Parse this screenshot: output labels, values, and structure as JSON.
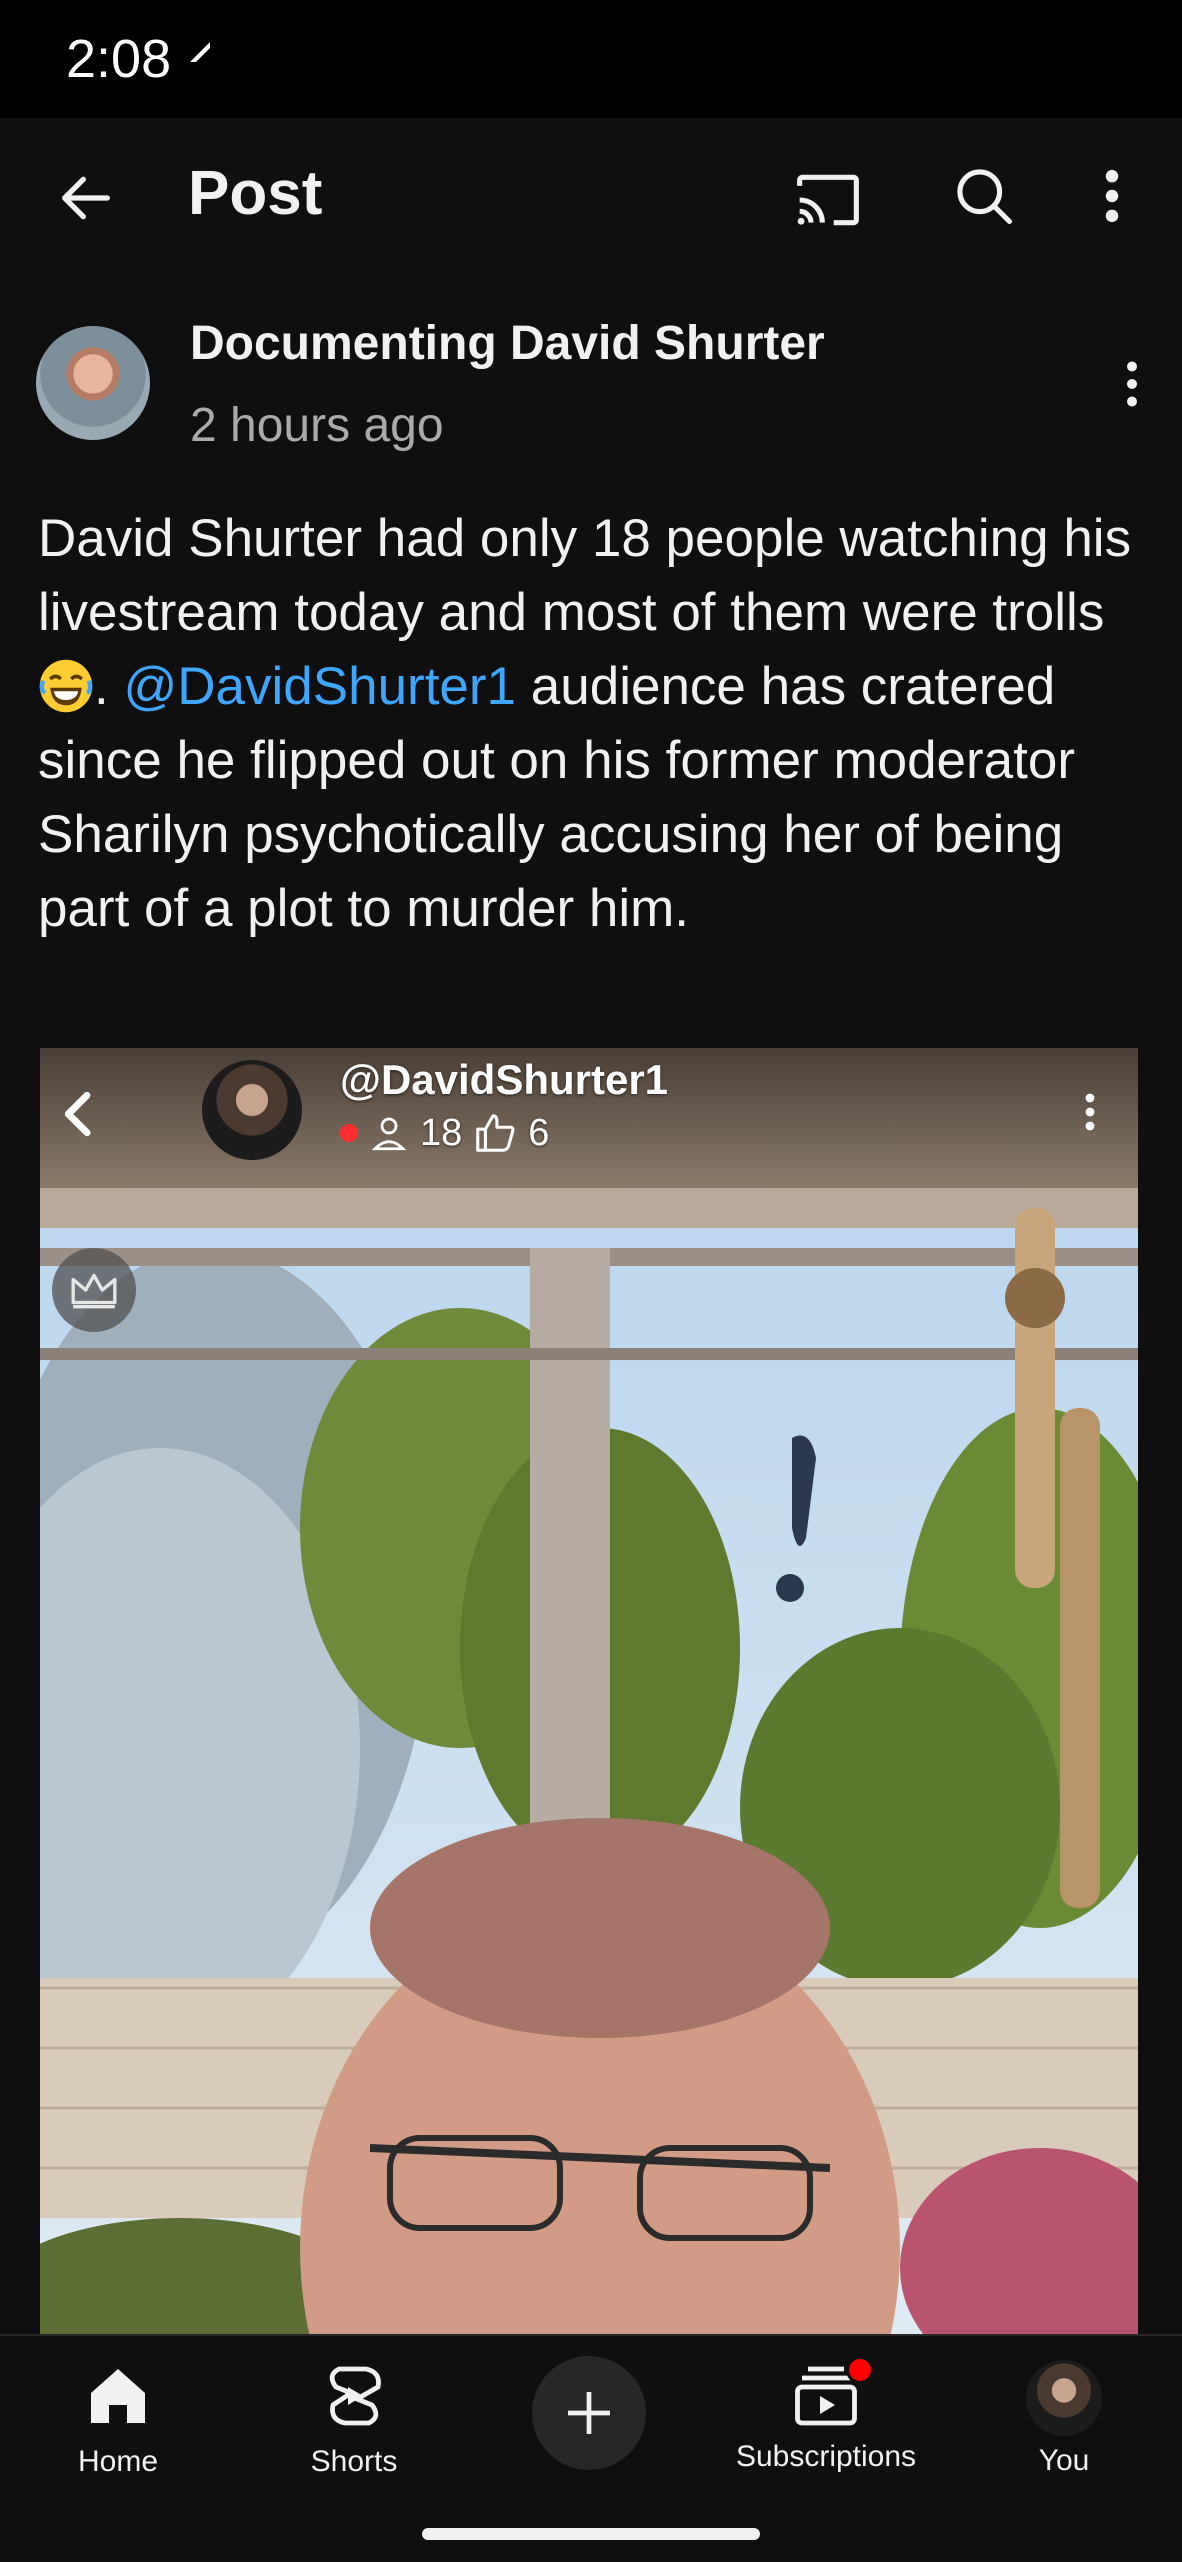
{
  "status_bar": {
    "time": "2:08"
  },
  "header": {
    "title": "Post"
  },
  "post": {
    "author": "Documenting David Shurter",
    "time": "2 hours ago",
    "text_1": "David Shurter had only 18 people watching his livestream today and most of them were trolls ",
    "text_2": ".  ",
    "mention": "@DavidShurter1",
    "text_3": " audience has cratered since he flipped out on his former moderator Sharilyn psychotically accusing her of being part of a plot to murder him."
  },
  "media": {
    "handle": "@DavidShurter1",
    "viewers": "18",
    "likes": "6"
  },
  "bottom_nav": {
    "home": "Home",
    "shorts": "Shorts",
    "subscriptions": "Subscriptions",
    "you": "You"
  },
  "colors": {
    "background": "#0f0f0f",
    "text": "#f1f1f1",
    "secondary_text": "#aaaaaa",
    "link": "#3ea6ff",
    "live_dot": "#ff2d2d",
    "notification_badge": "#ff0000"
  },
  "icons": [
    "signal-icon",
    "back-arrow-icon",
    "cast-icon",
    "search-icon",
    "more-vert-icon",
    "laughing-emoji-icon",
    "chevron-left-icon",
    "person-icon",
    "thumbs-up-icon",
    "crown-icon",
    "home-icon",
    "shorts-icon",
    "create-plus-icon",
    "subscriptions-icon"
  ]
}
